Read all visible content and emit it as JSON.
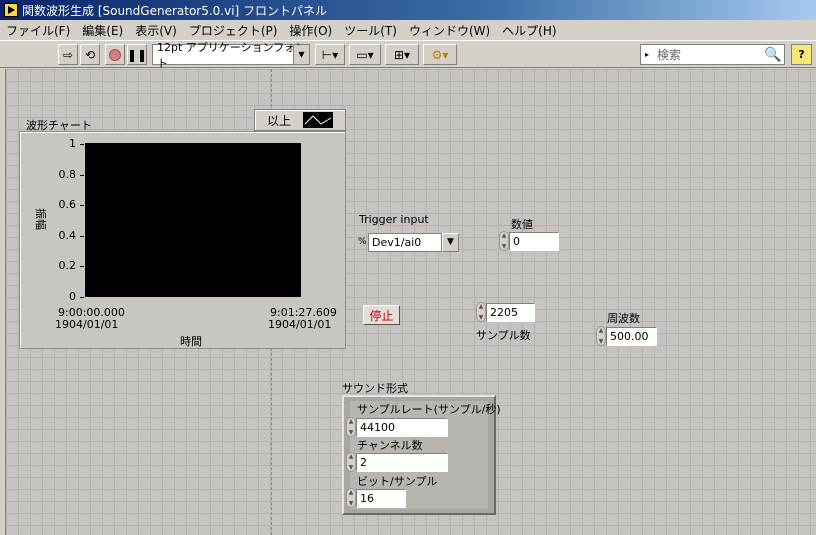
{
  "window": {
    "title": "関数波形生成 [SoundGenerator5.0.vi] フロントパネル"
  },
  "menu": [
    "ファイル(F)",
    "編集(E)",
    "表示(V)",
    "プロジェクト(P)",
    "操作(O)",
    "ツール(T)",
    "ウィンドウ(W)",
    "ヘルプ(H)"
  ],
  "toolbar": {
    "font": "12pt アプリケーションフォント",
    "search_placeholder": "検索",
    "help": "?"
  },
  "chart": {
    "label": "波形チャート",
    "legend_label": "以上",
    "y_axis_label": "振幅",
    "x_axis_label": "時間",
    "x_start_time": "9:00:00.000",
    "x_start_date": "1904/01/01",
    "x_end_time": "9:01:27.609",
    "x_end_date": "1904/01/01",
    "y_ticks": [
      "1",
      "0.8",
      "0.6",
      "0.4",
      "0.2",
      "0"
    ]
  },
  "trigger": {
    "label": "Trigger input",
    "value": "Dev1/ai0"
  },
  "numeric": {
    "label": "数値",
    "value": "0"
  },
  "stop": {
    "label": "停止"
  },
  "samples": {
    "label": "サンプル数",
    "value": "2205"
  },
  "frequency": {
    "label": "周波数",
    "value": "500.00"
  },
  "sound_format": {
    "label": "サウンド形式",
    "rate_label": "サンプルレート(サンプル/秒)",
    "rate_value": "44100",
    "channels_label": "チャンネル数",
    "channels_value": "2",
    "bits_label": "ビット/サンプル",
    "bits_value": "16"
  }
}
